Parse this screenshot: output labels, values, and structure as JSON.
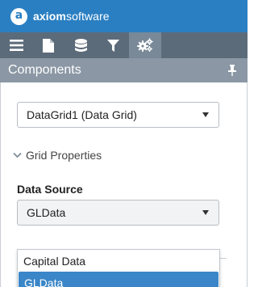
{
  "header": {
    "logo_letter": "a",
    "brand_bold": "axiom",
    "brand_rest": "software",
    "background": "#2a7fc2"
  },
  "toolbar": {
    "items": [
      {
        "icon": "menu-icon"
      },
      {
        "icon": "document-icon"
      },
      {
        "icon": "database-icon"
      },
      {
        "icon": "filter-icon"
      },
      {
        "icon": "gears-icon",
        "active": true
      }
    ]
  },
  "panel": {
    "title": "Components",
    "pin_icon": "pin-icon"
  },
  "component_select": {
    "value": "DataGrid1 (Data Grid)"
  },
  "grid_properties": {
    "label": "Grid Properties"
  },
  "data_source": {
    "label": "Data Source",
    "value": "GLData",
    "options": [
      "Capital Data",
      "GLData"
    ],
    "selected_index": 1,
    "selected_color": "#3a86c8"
  }
}
